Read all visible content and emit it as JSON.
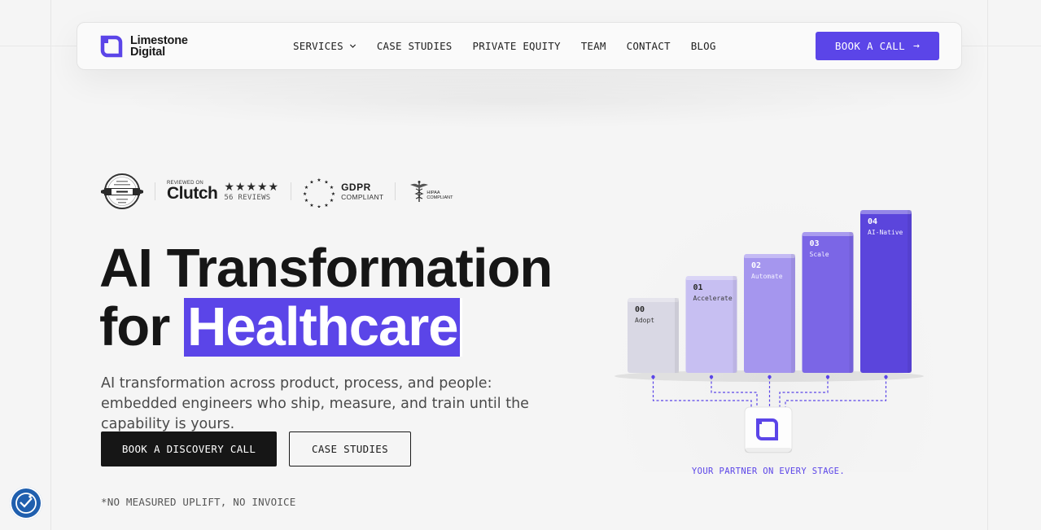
{
  "brand": {
    "name_line1": "Limestone",
    "name_line2": "Digital",
    "accent": "#5b45e8"
  },
  "nav": {
    "links": [
      {
        "label": "SERVICES",
        "has_dropdown": true
      },
      {
        "label": "CASE STUDIES"
      },
      {
        "label": "PRIVATE EQUITY"
      },
      {
        "label": "TEAM"
      },
      {
        "label": "CONTACT"
      },
      {
        "label": "BLOG"
      }
    ],
    "cta_label": "BOOK A CALL",
    "cta_arrow": "→"
  },
  "badges": {
    "clutch_reviewed_on": "REVIEWED ON",
    "clutch_word": "Clutch",
    "stars": "★★★★★",
    "reviews": "56 REVIEWS",
    "gdpr_title": "GDPR",
    "gdpr_sub": "COMPLIANT",
    "hipaa_line1": "HIPAA",
    "hipaa_line2": "COMPLIANT"
  },
  "hero": {
    "title_line1": "AI Transformation",
    "title_prefix": "for",
    "title_highlight": "Healthcare",
    "subtitle": "AI transformation across product, process, and people: embedded engineers who ship, measure, and train until the capability is yours.",
    "primary_cta": "BOOK A DISCOVERY CALL",
    "secondary_cta": "CASE STUDIES",
    "footnote": "*NO MEASURED UPLIFT, NO INVOICE"
  },
  "stages": [
    {
      "num": "00",
      "label": "Adopt",
      "level": 1,
      "color": "#d9d8e4"
    },
    {
      "num": "01",
      "label": "Accelerate",
      "level": 2,
      "color": "#c7bff2"
    },
    {
      "num": "02",
      "label": "Automate",
      "level": 3,
      "color": "#a596ee"
    },
    {
      "num": "03",
      "label": "Scale",
      "level": 4,
      "color": "#7b66e6"
    },
    {
      "num": "04",
      "label": "AI-Native",
      "level": 5,
      "color": "#5b45dc"
    }
  ],
  "partner_caption": "YOUR PARTNER ON EVERY STAGE.",
  "icons": {
    "accessibility": "accessibility-icon",
    "logo": "limestone-logo-icon",
    "dropdown": "chevron-down-icon"
  }
}
